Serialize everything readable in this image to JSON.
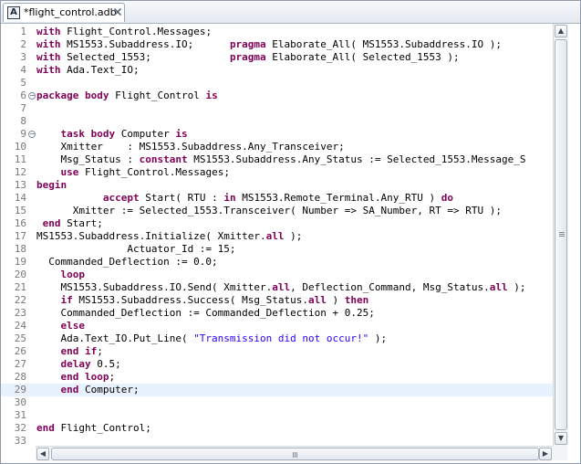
{
  "tab": {
    "icon_letter": "A",
    "title": "*flight_control.adb",
    "close_icon": "close-icon"
  },
  "editor": {
    "current_line": 29,
    "folds": [
      6,
      9
    ],
    "lines": [
      {
        "n": "1",
        "segs": [
          [
            "with",
            "kw"
          ],
          [
            " Flight_Control.Messages;",
            ""
          ]
        ]
      },
      {
        "n": "2",
        "segs": [
          [
            "with",
            "kw"
          ],
          [
            " MS1553.Subaddress.IO;      ",
            ""
          ],
          [
            "pragma",
            "kw"
          ],
          [
            " Elaborate_All( MS1553.Subaddress.IO );",
            ""
          ]
        ]
      },
      {
        "n": "3",
        "segs": [
          [
            "with",
            "kw"
          ],
          [
            " Selected_1553;             ",
            ""
          ],
          [
            "pragma",
            "kw"
          ],
          [
            " Elaborate_All( Selected_1553 );",
            ""
          ]
        ]
      },
      {
        "n": "4",
        "segs": [
          [
            "with",
            "kw"
          ],
          [
            " Ada.Text_IO;",
            ""
          ]
        ]
      },
      {
        "n": "5",
        "segs": []
      },
      {
        "n": "6",
        "segs": [
          [
            "package body",
            "kw"
          ],
          [
            " Flight_Control ",
            ""
          ],
          [
            "is",
            "kw"
          ]
        ]
      },
      {
        "n": "7",
        "segs": []
      },
      {
        "n": "8",
        "segs": []
      },
      {
        "n": "9",
        "segs": [
          [
            "    ",
            ""
          ],
          [
            "task body",
            "kw"
          ],
          [
            " Computer ",
            ""
          ],
          [
            "is",
            "kw"
          ]
        ]
      },
      {
        "n": "10",
        "segs": [
          [
            "    Xmitter    : MS1553.Subaddress.Any_Transceiver;",
            ""
          ]
        ]
      },
      {
        "n": "11",
        "segs": [
          [
            "    Msg_Status : ",
            ""
          ],
          [
            "constant",
            "kw"
          ],
          [
            " MS1553.Subaddress.Any_Status := Selected_1553.Message_S",
            ""
          ]
        ]
      },
      {
        "n": "12",
        "segs": [
          [
            "    ",
            ""
          ],
          [
            "use",
            "kw"
          ],
          [
            " Flight_Control.Messages;",
            ""
          ]
        ]
      },
      {
        "n": "13",
        "segs": [
          [
            "begin",
            "kw"
          ]
        ]
      },
      {
        "n": "14",
        "segs": [
          [
            "           ",
            ""
          ],
          [
            "accept",
            "kw"
          ],
          [
            " Start( RTU : ",
            ""
          ],
          [
            "in",
            "kw"
          ],
          [
            " MS1553.Remote_Terminal.Any_RTU ) ",
            ""
          ],
          [
            "do",
            "kw"
          ]
        ]
      },
      {
        "n": "15",
        "segs": [
          [
            "      Xmitter := Selected_1553.Transceiver( Number => SA_Number, RT => RTU );",
            ""
          ]
        ]
      },
      {
        "n": "16",
        "segs": [
          [
            " ",
            ""
          ],
          [
            "end",
            "kw"
          ],
          [
            " Start;",
            ""
          ]
        ]
      },
      {
        "n": "17",
        "segs": [
          [
            "MS1553.Subaddress.Initialize( Xmitter.",
            ""
          ],
          [
            "all",
            "kw"
          ],
          [
            " );",
            ""
          ]
        ]
      },
      {
        "n": "18",
        "segs": [
          [
            "               Actuator_Id := 15;",
            ""
          ]
        ]
      },
      {
        "n": "19",
        "segs": [
          [
            "  Commanded_Deflection := 0.0;",
            ""
          ]
        ]
      },
      {
        "n": "20",
        "segs": [
          [
            "    ",
            ""
          ],
          [
            "loop",
            "kw"
          ]
        ]
      },
      {
        "n": "21",
        "segs": [
          [
            "    MS1553.Subaddress.IO.Send( Xmitter.",
            ""
          ],
          [
            "all",
            "kw"
          ],
          [
            ", Deflection_Command, Msg_Status.",
            ""
          ],
          [
            "all",
            "kw"
          ],
          [
            " );",
            ""
          ]
        ]
      },
      {
        "n": "22",
        "segs": [
          [
            "    ",
            ""
          ],
          [
            "if",
            "kw"
          ],
          [
            " MS1553.Subaddress.Success( Msg_Status.",
            ""
          ],
          [
            "all",
            "kw"
          ],
          [
            " ) ",
            ""
          ],
          [
            "then",
            "kw"
          ]
        ]
      },
      {
        "n": "23",
        "segs": [
          [
            "    Commanded_Deflection := Commanded_Deflection + 0.25;",
            ""
          ]
        ]
      },
      {
        "n": "24",
        "segs": [
          [
            "    ",
            ""
          ],
          [
            "else",
            "kw"
          ]
        ]
      },
      {
        "n": "25",
        "segs": [
          [
            "    Ada.Text_IO.Put_Line( ",
            ""
          ],
          [
            "\"Transmission did not occur!\"",
            "str"
          ],
          [
            " );",
            ""
          ]
        ]
      },
      {
        "n": "26",
        "segs": [
          [
            "    ",
            ""
          ],
          [
            "end if",
            "kw"
          ],
          [
            ";",
            ""
          ]
        ]
      },
      {
        "n": "27",
        "segs": [
          [
            "    ",
            ""
          ],
          [
            "delay",
            "kw"
          ],
          [
            " 0.5;",
            ""
          ]
        ]
      },
      {
        "n": "28",
        "segs": [
          [
            "    ",
            ""
          ],
          [
            "end loop",
            "kw"
          ],
          [
            ";",
            ""
          ]
        ]
      },
      {
        "n": "29",
        "segs": [
          [
            "    ",
            ""
          ],
          [
            "end",
            "kw"
          ],
          [
            " Computer;",
            ""
          ]
        ]
      },
      {
        "n": "30",
        "segs": []
      },
      {
        "n": "31",
        "segs": []
      },
      {
        "n": "32",
        "segs": [
          [
            "end",
            "kw"
          ],
          [
            " Flight_Control;",
            ""
          ]
        ]
      },
      {
        "n": "33",
        "segs": []
      }
    ]
  },
  "scrollbars": {
    "up_arrow": "▲",
    "down_arrow": "▼",
    "left_arrow": "◀",
    "right_arrow": "▶"
  }
}
